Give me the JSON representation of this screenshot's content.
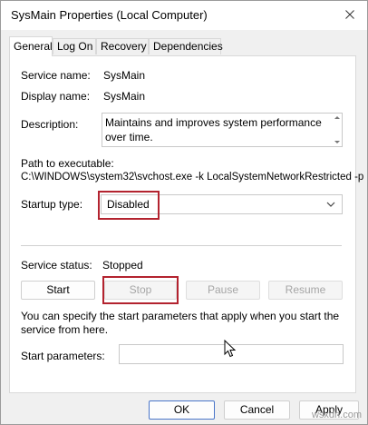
{
  "window": {
    "title": "SysMain Properties (Local Computer)"
  },
  "tabs": [
    {
      "label": "General",
      "active": true
    },
    {
      "label": "Log On",
      "active": false
    },
    {
      "label": "Recovery",
      "active": false
    },
    {
      "label": "Dependencies",
      "active": false
    }
  ],
  "general": {
    "service_name_label": "Service name:",
    "service_name_value": "SysMain",
    "display_name_label": "Display name:",
    "display_name_value": "SysMain",
    "description_label": "Description:",
    "description_value": "Maintains and improves system performance over time.",
    "path_label": "Path to executable:",
    "path_value": "C:\\WINDOWS\\system32\\svchost.exe -k LocalSystemNetworkRestricted -p",
    "startup_type_label": "Startup type:",
    "startup_type_value": "Disabled",
    "service_status_label": "Service status:",
    "service_status_value": "Stopped",
    "start_label": "Start",
    "stop_label": "Stop",
    "pause_label": "Pause",
    "resume_label": "Resume",
    "help_text": "You can specify the start parameters that apply when you start the service from here.",
    "start_params_label": "Start parameters:",
    "start_params_value": ""
  },
  "footer": {
    "ok_label": "OK",
    "cancel_label": "Cancel",
    "apply_label": "Apply"
  },
  "watermark": "wsxdn.com",
  "colors": {
    "highlight": "#b3232f",
    "panel_bg": "#ffffff",
    "dialog_bg": "#f0f0f0"
  },
  "icons": {
    "close": "close-icon",
    "dropdown": "chevron-down-icon",
    "cursor": "mouse-pointer-icon"
  }
}
